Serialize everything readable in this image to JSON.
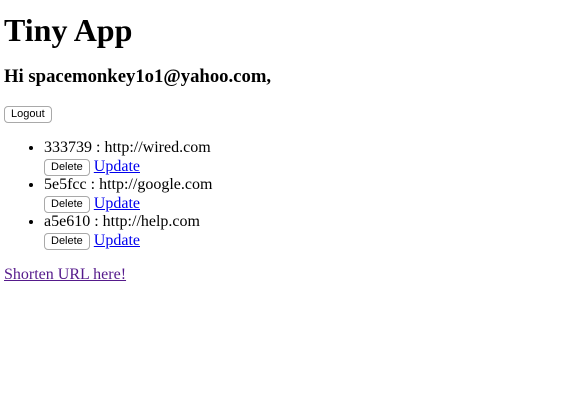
{
  "app": {
    "title": "Tiny App",
    "greeting": "Hi spacemonkey1o1@yahoo.com,"
  },
  "header": {
    "logout_label": "Logout"
  },
  "urls": [
    {
      "id": "333739",
      "separator": ":",
      "long_url": "http://wired.com",
      "delete_label": "Delete",
      "update_label": "Update"
    },
    {
      "id": "5e5fcc",
      "separator": ":",
      "long_url": "http://google.com",
      "delete_label": "Delete",
      "update_label": "Update"
    },
    {
      "id": "a5e610",
      "separator": ":",
      "long_url": "http://help.com",
      "delete_label": "Delete",
      "update_label": "Update"
    }
  ],
  "footer": {
    "shorten_link": "Shorten URL here!"
  },
  "colors": {
    "link": "#0000ee",
    "visited_link": "#551a8b",
    "background": "#ffffff"
  }
}
